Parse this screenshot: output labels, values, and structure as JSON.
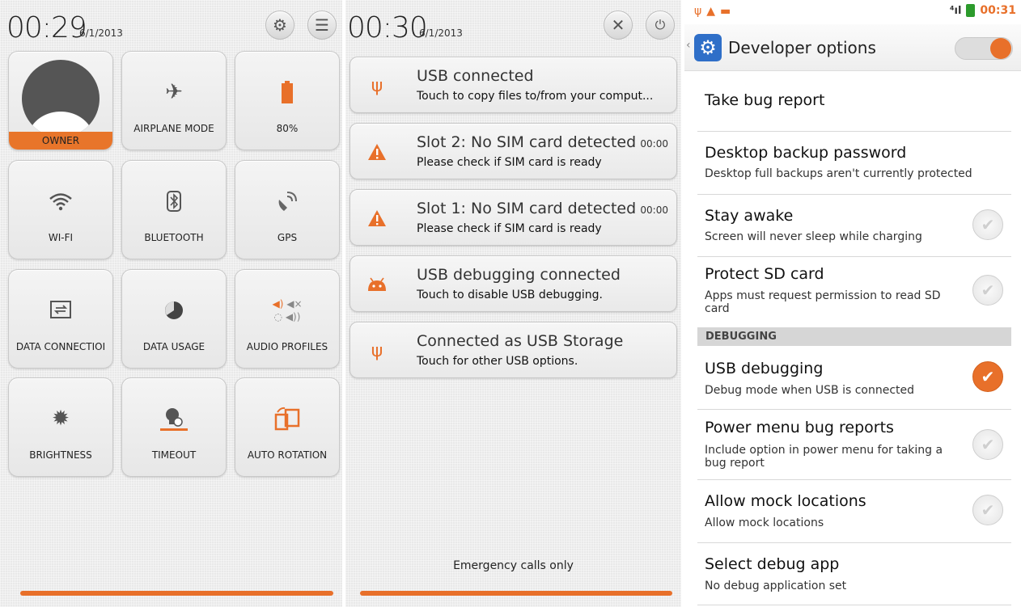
{
  "shade1": {
    "time": "00:29",
    "date": "6/1/2013",
    "settings_icon": "gear-icon",
    "menu_icon": "list-icon",
    "tiles": [
      {
        "label": "OWNER",
        "icon": "avatar"
      },
      {
        "label": "AIRPLANE MODE",
        "icon": "airplane-icon"
      },
      {
        "label": "80%",
        "icon": "battery-icon"
      },
      {
        "label": "WI-FI",
        "icon": "wifi-icon"
      },
      {
        "label": "BLUETOOTH",
        "icon": "bluetooth-icon"
      },
      {
        "label": "GPS",
        "icon": "gps-icon"
      },
      {
        "label": "DATA CONNECTIOI",
        "icon": "data-connection-icon"
      },
      {
        "label": "DATA USAGE",
        "icon": "data-usage-icon"
      },
      {
        "label": "AUDIO PROFILES",
        "icon": "audio-profiles-icon"
      },
      {
        "label": "BRIGHTNESS",
        "icon": "brightness-icon"
      },
      {
        "label": "TIMEOUT",
        "icon": "timeout-icon"
      },
      {
        "label": "AUTO ROTATION",
        "icon": "auto-rotation-icon"
      }
    ]
  },
  "shade2": {
    "time": "00:30",
    "date": "6/1/2013",
    "notifications": [
      {
        "title": "USB connected",
        "text": "Touch to copy files to/from your comput...",
        "time": "",
        "icon": "usb-icon"
      },
      {
        "title": "Slot 2: No SIM card detected",
        "text": "Please check if SIM card is ready",
        "time": "00:00",
        "icon": "warning-icon"
      },
      {
        "title": "Slot 1: No SIM card detected",
        "text": "Please check if SIM card is ready",
        "time": "00:00",
        "icon": "warning-icon"
      },
      {
        "title": "USB debugging connected",
        "text": "Touch to disable USB debugging.",
        "time": "",
        "icon": "android-icon"
      },
      {
        "title": "Connected as USB Storage",
        "text": "Touch for other USB options.",
        "time": "",
        "icon": "usb-icon"
      }
    ],
    "emergency": "Emergency calls only"
  },
  "settings": {
    "status_time": "00:31",
    "title": "Developer options",
    "accent": "#e8702a",
    "rows": [
      {
        "title": "Take bug report",
        "subtitle": "",
        "checkbox": "none"
      },
      {
        "title": "Desktop backup password",
        "subtitle": "Desktop full backups aren't currently protected",
        "checkbox": "none"
      },
      {
        "title": "Stay awake",
        "subtitle": "Screen will never sleep while charging",
        "checkbox": "off"
      },
      {
        "title": "Protect SD card",
        "subtitle": "Apps must request permission to read SD card",
        "checkbox": "off"
      },
      {
        "title": "USB debugging",
        "subtitle": "Debug mode when USB is connected",
        "checkbox": "on"
      },
      {
        "title": "Power menu bug reports",
        "subtitle": "Include option in power menu for taking a bug report",
        "checkbox": "off"
      },
      {
        "title": "Allow mock locations",
        "subtitle": "Allow mock locations",
        "checkbox": "off"
      },
      {
        "title": "Select debug app",
        "subtitle": "No debug application set",
        "checkbox": "none"
      }
    ],
    "section_debugging": "DEBUGGING"
  }
}
